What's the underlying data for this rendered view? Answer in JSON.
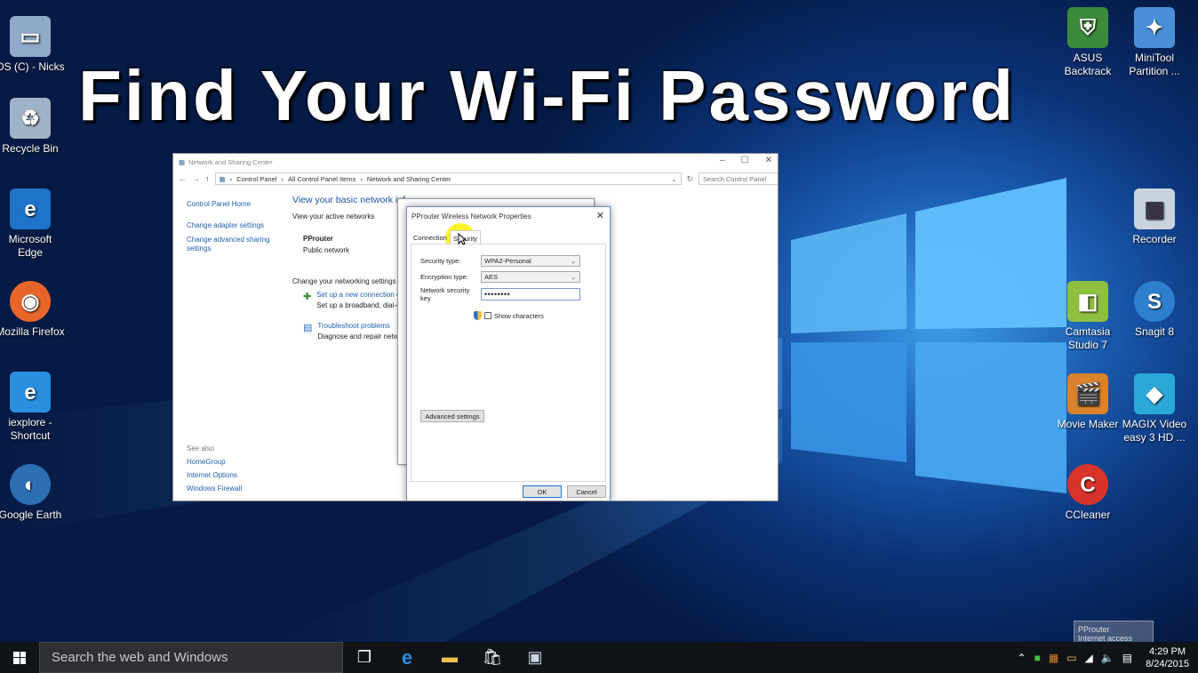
{
  "headline": "Find Your Wi-Fi Password",
  "desktop_icons": [
    {
      "label": "OS (C) - Nicks",
      "icon": "drive-icon",
      "color": "#8fa9c9"
    },
    {
      "label": "Recycle Bin",
      "icon": "recycle-bin-icon",
      "color": "#9fb3c8"
    },
    {
      "label": "Microsoft Edge",
      "icon": "edge-icon",
      "color": "#1f74c9"
    },
    {
      "label": "Mozilla Firefox",
      "icon": "firefox-icon",
      "color": "#e8652a"
    },
    {
      "label": "iexplore - Shortcut",
      "icon": "ie-icon",
      "color": "#2a8fe0"
    },
    {
      "label": "Google Earth",
      "icon": "google-earth-icon",
      "color": "#2c6fb2"
    },
    {
      "label": "ASUS Backtrack",
      "icon": "asus-backtrack-icon",
      "color": "#3c8a3c"
    },
    {
      "label": "MiniTool Partition ...",
      "icon": "minitool-icon",
      "color": "#4a90d9"
    },
    {
      "label": "Recorder",
      "icon": "recorder-icon",
      "color": "#c9d3dd"
    },
    {
      "label": "Camtasia Studio 7",
      "icon": "camtasia-icon",
      "color": "#8fbf3f"
    },
    {
      "label": "Snagit 8",
      "icon": "snagit-icon",
      "color": "#2f7fcf"
    },
    {
      "label": "Movie Maker",
      "icon": "movie-maker-icon",
      "color": "#d9822b"
    },
    {
      "label": "MAGIX Video easy 3 HD ...",
      "icon": "magix-icon",
      "color": "#2aa8d8"
    },
    {
      "label": "CCleaner",
      "icon": "ccleaner-icon",
      "color": "#d9342b"
    }
  ],
  "window": {
    "title": "Network and Sharing Center",
    "breadcrumb": [
      "Control Panel",
      "All Control Panel Items",
      "Network and Sharing Center"
    ],
    "search_placeholder": "Search Control Panel",
    "left_nav": [
      "Control Panel Home",
      "Change adapter settings",
      "Change advanced sharing settings"
    ],
    "see_also_heading": "See also",
    "see_also": [
      "HomeGroup",
      "Internet Options",
      "Windows Firewall"
    ],
    "main_title": "View your basic network inf",
    "active_networks_label": "View your active networks",
    "network_name": "PProuter",
    "network_type": "Public network",
    "change_settings_label": "Change your networking settings",
    "setup_link": "Set up a new connection o",
    "setup_desc": "Set up a broadband, dial-u",
    "troubleshoot_link": "Troubleshoot problems",
    "troubleshoot_desc": "Diagnose and repair netw"
  },
  "dialog": {
    "title": "PProuter Wireless Network Properties",
    "tabs": [
      "Connection",
      "Security"
    ],
    "security_type_label": "Security type:",
    "security_type_value": "WPA2-Personal",
    "encryption_type_label": "Encryption type:",
    "encryption_type_value": "AES",
    "key_label": "Network security key",
    "key_value": "••••••••",
    "show_characters": "Show characters",
    "advanced_button": "Advanced settings",
    "ok_button": "OK",
    "cancel_button": "Cancel"
  },
  "taskbar": {
    "search_placeholder": "Search the web and Windows",
    "time": "4:29 PM",
    "date": "8/24/2015",
    "toast_line1": "PProuter",
    "toast_line2": "Internet access"
  }
}
